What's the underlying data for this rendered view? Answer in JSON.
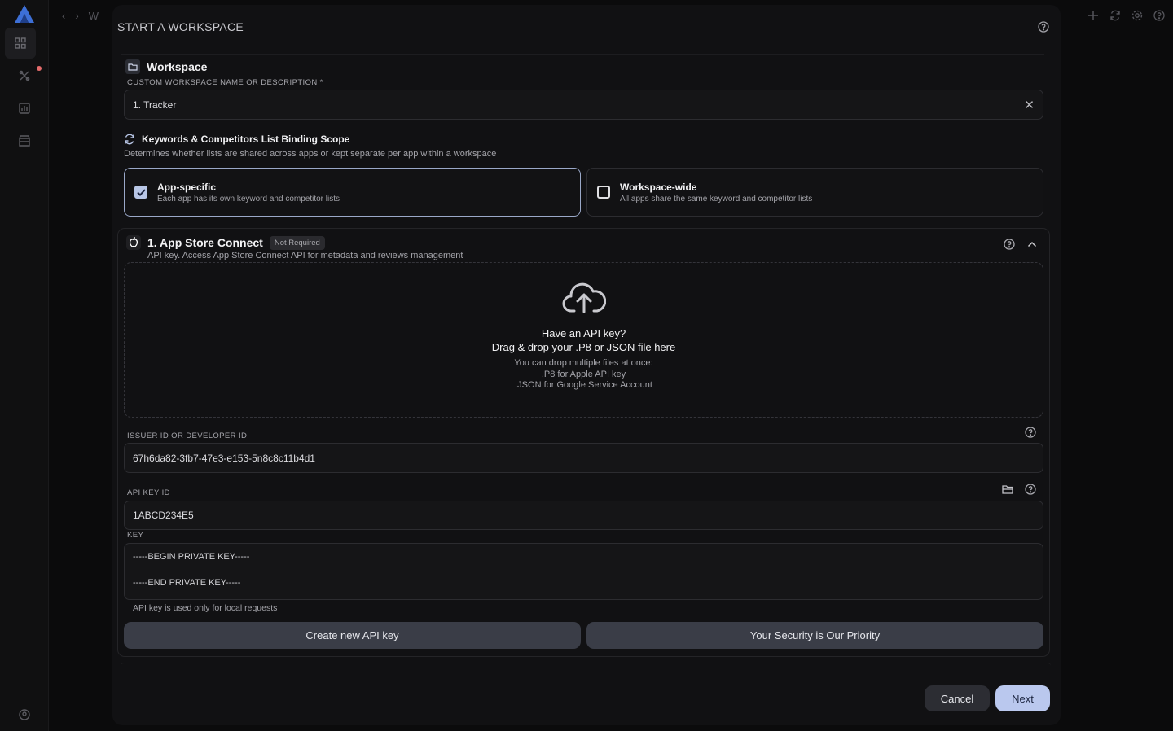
{
  "app": {
    "breadcrumb_partial": "W"
  },
  "modal": {
    "title": "START A WORKSPACE"
  },
  "workspace": {
    "section_title": "Workspace",
    "name_label": "CUSTOM WORKSPACE NAME OR DESCRIPTION *",
    "name_value": "1. Tracker"
  },
  "scope": {
    "title": "Keywords & Competitors List Binding Scope",
    "description": "Determines whether lists are shared across apps or kept separate per app within a workspace",
    "options": [
      {
        "title": "App-specific",
        "desc": "Each app has its own keyword and competitor lists",
        "checked": true
      },
      {
        "title": "Workspace-wide",
        "desc": "All apps share the same keyword and competitor lists",
        "checked": false
      }
    ]
  },
  "asc": {
    "title": "1. App Store Connect",
    "badge": "Not Required",
    "description": "API key. Access App Store Connect API for metadata and reviews management",
    "dropzone": {
      "line1": "Have an API key?",
      "line2": "Drag & drop your .P8 or JSON file here",
      "hint1": "You can drop multiple files at once:",
      "hint2": ".P8 for Apple API key",
      "hint3": ".JSON for Google Service Account"
    },
    "issuer_label": "ISSUER ID OR DEVELOPER ID",
    "issuer_value": "67h6da82-3fb7-47e3-e153-5n8c8c11b4d1",
    "key_id_label": "API KEY ID",
    "key_id_value": "1ABCD234E5",
    "key_label": "KEY",
    "key_begin": "-----BEGIN PRIVATE KEY-----",
    "key_end": "-----END PRIVATE KEY-----",
    "key_note": "API key is used only for local requests",
    "create_button": "Create new API key",
    "security_button": "Your Security is Our Priority"
  },
  "footer": {
    "cancel": "Cancel",
    "next": "Next"
  },
  "colors": {
    "accent": "#bac8ee",
    "background": "#0b0b0c",
    "modal": "#111113"
  }
}
